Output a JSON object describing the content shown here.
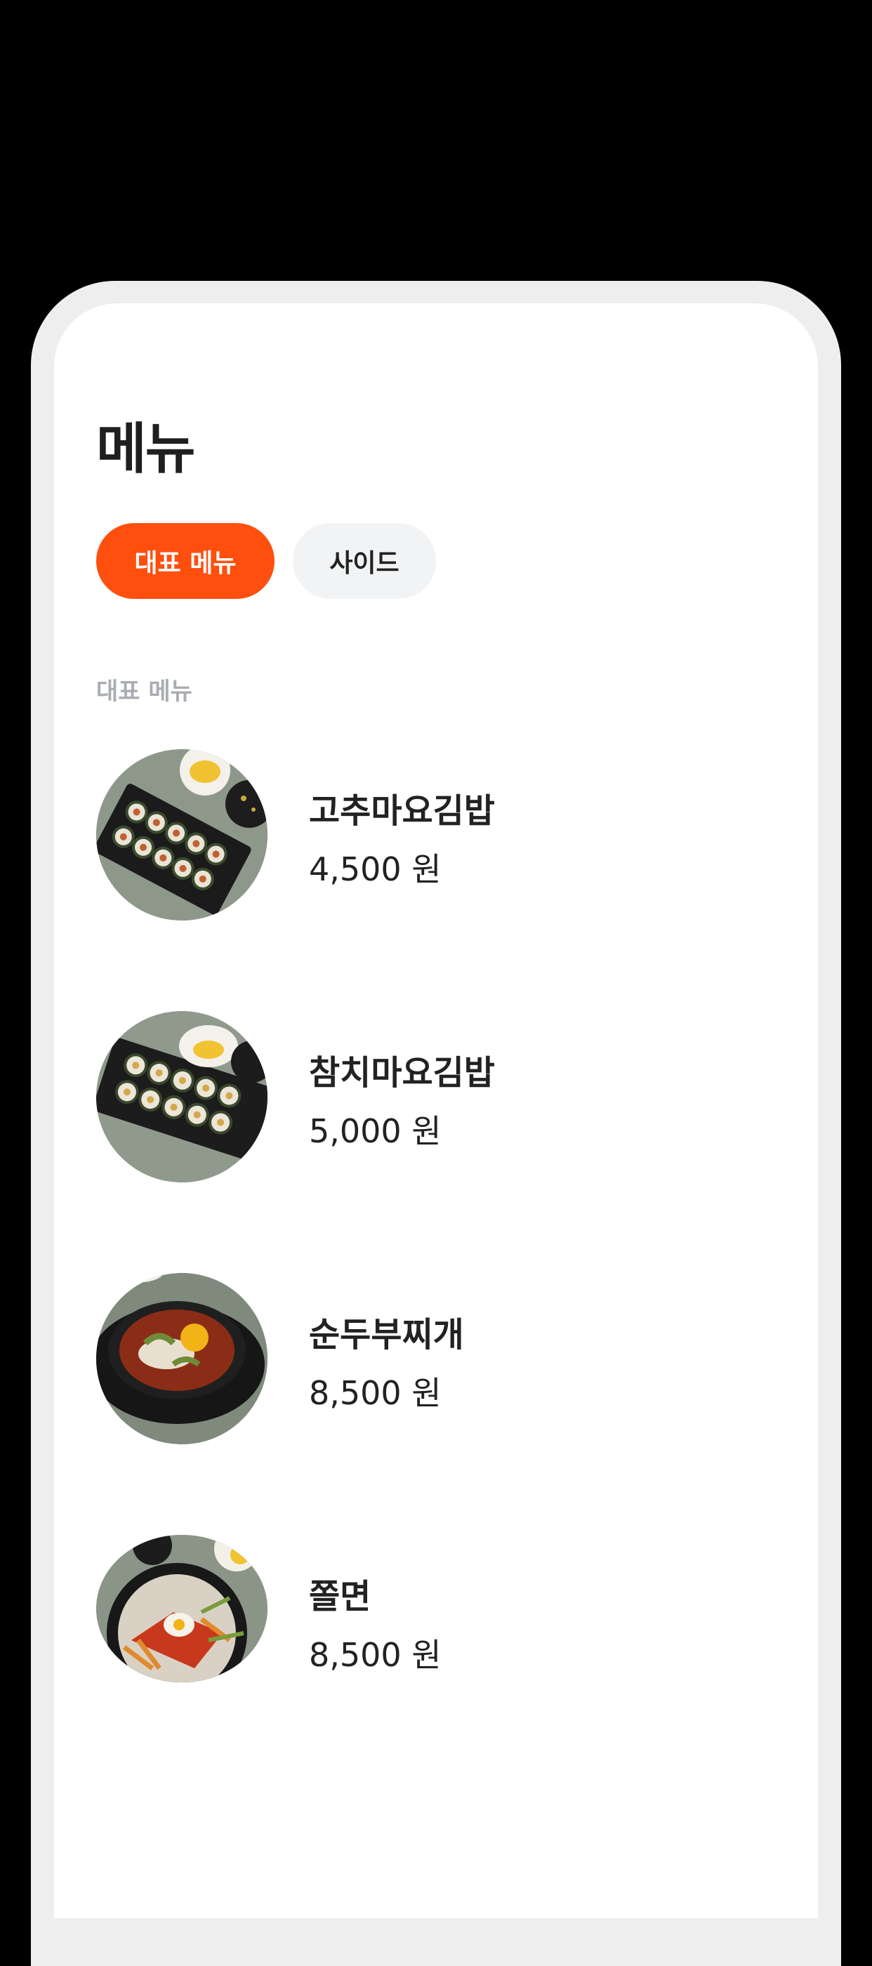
{
  "page": {
    "title": "메뉴"
  },
  "tabs": [
    {
      "label": "대표 메뉴",
      "active": true
    },
    {
      "label": "사이드",
      "active": false
    }
  ],
  "section": {
    "label": "대표 메뉴"
  },
  "menu_items": [
    {
      "name": "고추마요김밥",
      "price": "4,500 원",
      "image": "gimbap-platter"
    },
    {
      "name": "참치마요김밥",
      "price": "5,000 원",
      "image": "gimbap-platter"
    },
    {
      "name": "순두부찌개",
      "price": "8,500 원",
      "image": "soft-tofu-stew"
    },
    {
      "name": "쫄면",
      "price": "8,500 원",
      "image": "spicy-noodles"
    }
  ],
  "colors": {
    "accent": "#ff4f0f",
    "tab_inactive_bg": "#f2f3f5",
    "section_label": "#a9acb2",
    "text": "#222222"
  }
}
